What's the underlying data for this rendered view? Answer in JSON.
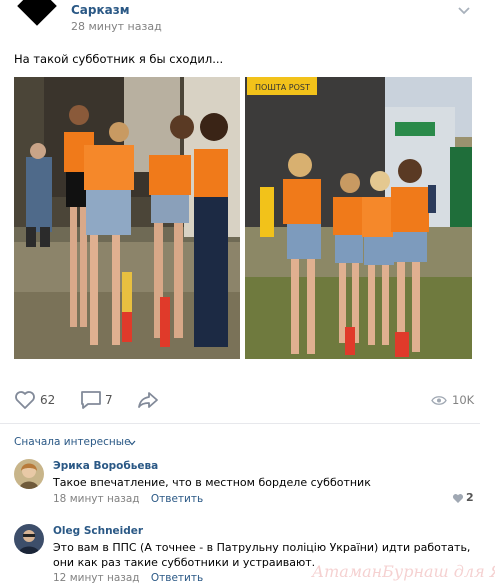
{
  "post": {
    "group_name": "Сарказм",
    "time": "28 минут назад",
    "text": "На такой субботник я бы сходил..."
  },
  "stats": {
    "likes": "62",
    "comments": "7",
    "views": "10K"
  },
  "photo_1": {
    "sign": ""
  },
  "photo_2": {
    "sign": "ПОШТА POST"
  },
  "comments_section": {
    "sort_label": "Сначала интересные"
  },
  "comments": [
    {
      "author": "Эрика Воробьева",
      "text": "Такое впечатление, что в местном борделе субботник",
      "time": "18 минут назад",
      "reply": "Ответить",
      "likes": "2"
    },
    {
      "author": "Oleg Schneider",
      "text": "Это вам в ППС (А точнее - в Патрульну поліцію України) идти работать, они как раз такие субботники и устраивают.",
      "time": "12 минут назад",
      "reply": "Ответить"
    }
  ],
  "watermark": "АтаманБурнаш для ЯП",
  "colors": {
    "link": "#2a5885",
    "muted": "#828282",
    "vest_orange": "#f07a1a"
  }
}
